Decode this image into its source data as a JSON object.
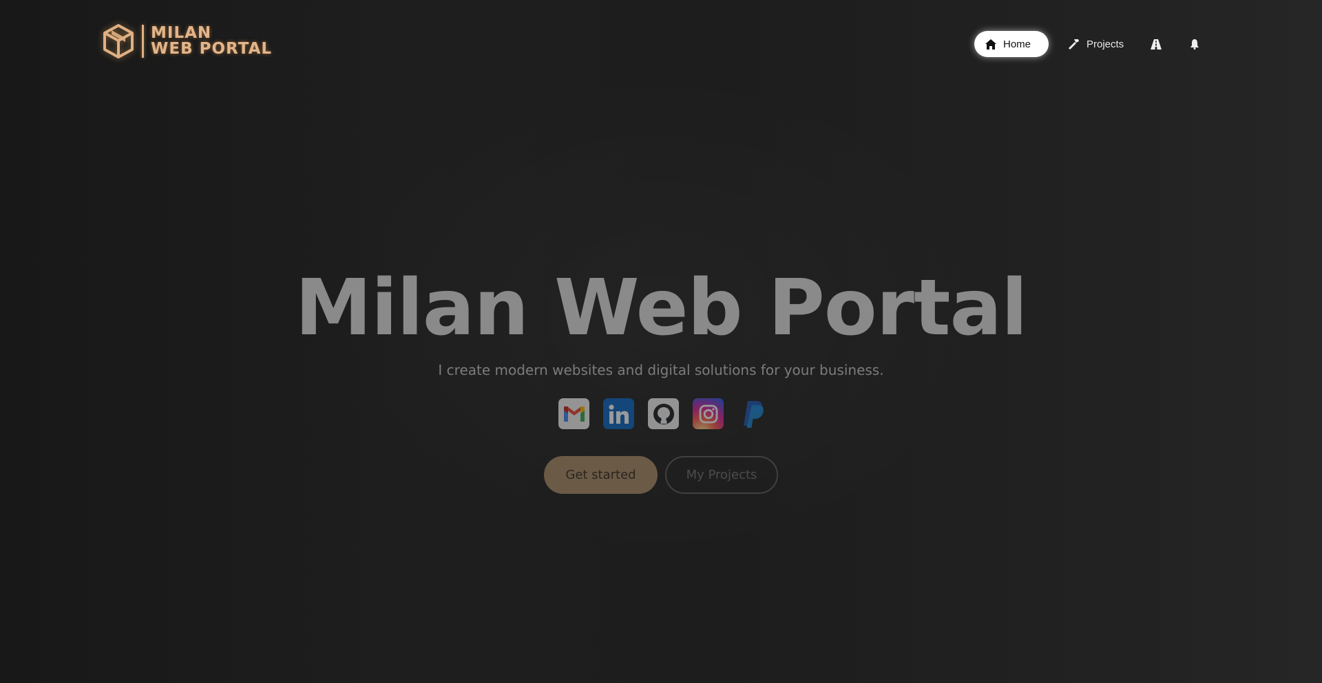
{
  "header": {
    "logo": {
      "line1": "MILAN",
      "line2": "WEB PORTAL",
      "icon": "cube-icon",
      "color": "#e3b58a"
    },
    "nav": [
      {
        "label": "Home",
        "icon": "home-icon",
        "active": true
      },
      {
        "label": "Projects",
        "icon": "hammer-icon",
        "active": false
      },
      {
        "label": "",
        "icon": "road-icon",
        "active": false
      },
      {
        "label": "",
        "icon": "bell-icon",
        "active": false
      }
    ]
  },
  "hero": {
    "title": "Milan Web Portal",
    "subtitle": "I create modern websites and digital solutions for your business.",
    "socials": [
      {
        "name": "Gmail",
        "icon": "gmail-icon"
      },
      {
        "name": "LinkedIn",
        "icon": "linkedin-icon"
      },
      {
        "name": "GitHub",
        "icon": "github-icon"
      },
      {
        "name": "Instagram",
        "icon": "instagram-icon"
      },
      {
        "name": "PayPal",
        "icon": "paypal-icon"
      }
    ],
    "primary_button": "Get started",
    "secondary_button": "My Projects"
  },
  "colors": {
    "background": "#1c1c1c",
    "accent": "#e3b58a",
    "primary_button": "#6b5a46"
  }
}
